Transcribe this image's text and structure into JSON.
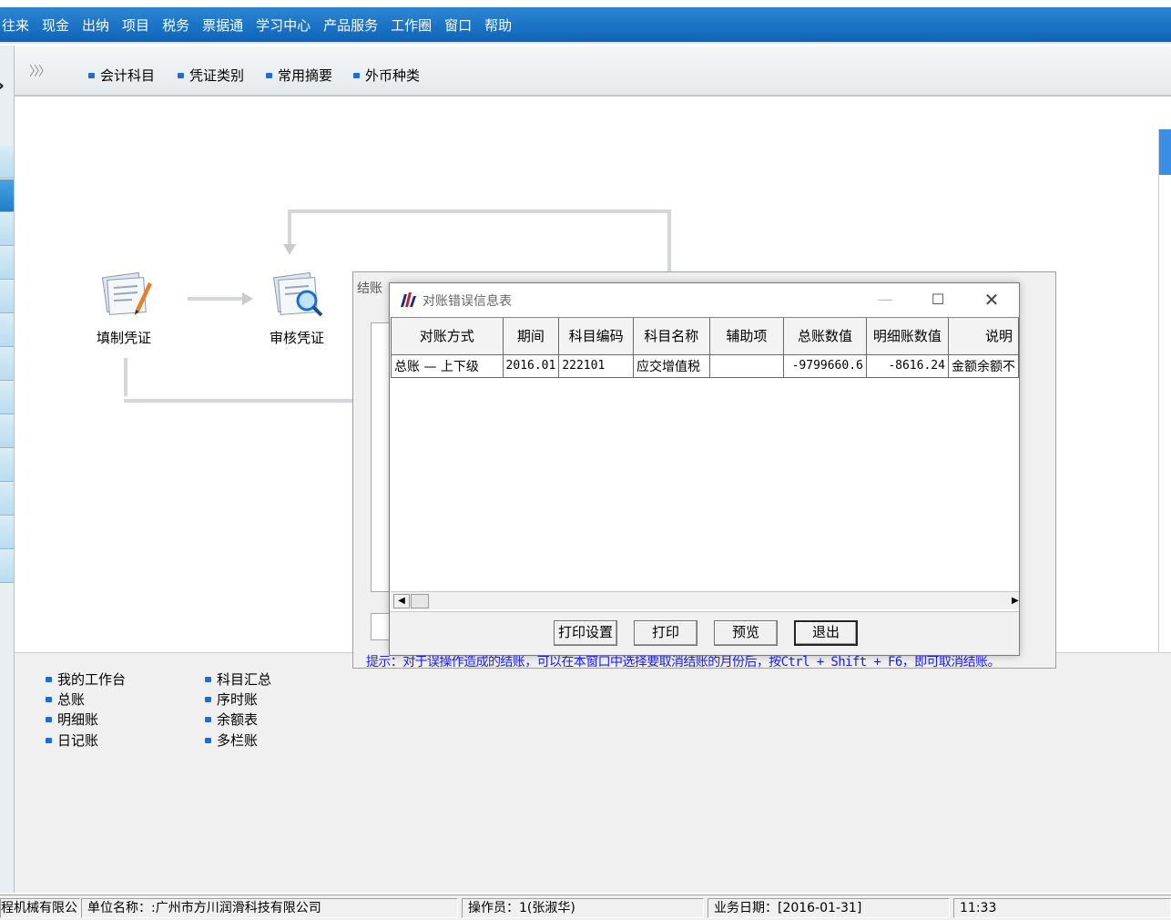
{
  "menubar": {
    "items": [
      "往来",
      "现金",
      "出纳",
      "项目",
      "税务",
      "票据通",
      "学习中心",
      "产品服务",
      "工作圈",
      "窗口",
      "帮助"
    ]
  },
  "toolbar": {
    "items": [
      "会计科目",
      "凭证类别",
      "常用摘要",
      "外币种类"
    ]
  },
  "flow": {
    "fill_voucher": "填制凭证",
    "review_voucher": "审核凭证"
  },
  "quick_links": {
    "left": [
      "我的工作台",
      "总账",
      "明细账",
      "日记账"
    ],
    "right": [
      "科目汇总",
      "序时账",
      "余额表",
      "多栏账"
    ]
  },
  "bg_dialog": {
    "title": "结账",
    "hint": "提示：对于误操作造成的结账，可以在本窗口中选择要取消结账的月份后，按Ctrl + Shift + F6，即可取消结账。"
  },
  "dialog": {
    "title": "对账错误信息表",
    "columns": [
      "对账方式",
      "期间",
      "科目编码",
      "科目名称",
      "辅助项",
      "总账数值",
      "明细账数值",
      "说明"
    ],
    "rows": [
      [
        "总账 — 上下级",
        "2016.01",
        "222101",
        "应交增值税",
        "",
        "-9799660.6",
        "-8616.24",
        "金额余额不"
      ]
    ],
    "buttons": {
      "print_setup": "打印设置",
      "print": "打印",
      "preview": "预览",
      "exit": "退出"
    }
  },
  "statusbar": {
    "company_short": "程机械有限公",
    "unit": "单位名称：:广州市方川润滑科技有限公司",
    "operator": "操作员：1(张淑华)",
    "business_date": "业务日期：[2016-01-31]",
    "time": "11:33"
  },
  "colors": {
    "menubar": "#1a70c4",
    "hint_text": "#1a1aff",
    "accent": "#1a6fd6"
  }
}
